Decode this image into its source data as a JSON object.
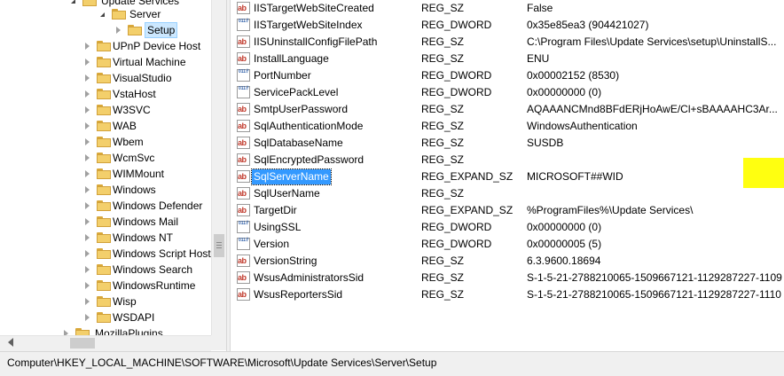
{
  "tree": {
    "nodes": [
      {
        "label": "Update Services",
        "state": "expanded"
      },
      {
        "label": "Server",
        "state": "expanded"
      },
      {
        "label": "Setup",
        "state": "none",
        "selected": true
      },
      {
        "label": "UPnP Device Host",
        "state": "collapsed"
      },
      {
        "label": "Virtual Machine",
        "state": "collapsed"
      },
      {
        "label": "VisualStudio",
        "state": "collapsed"
      },
      {
        "label": "VstaHost",
        "state": "collapsed"
      },
      {
        "label": "W3SVC",
        "state": "collapsed"
      },
      {
        "label": "WAB",
        "state": "collapsed"
      },
      {
        "label": "Wbem",
        "state": "collapsed"
      },
      {
        "label": "WcmSvc",
        "state": "collapsed"
      },
      {
        "label": "WIMMount",
        "state": "collapsed"
      },
      {
        "label": "Windows",
        "state": "collapsed"
      },
      {
        "label": "Windows Defender",
        "state": "collapsed"
      },
      {
        "label": "Windows Mail",
        "state": "collapsed"
      },
      {
        "label": "Windows NT",
        "state": "collapsed"
      },
      {
        "label": "Windows Script Host",
        "state": "collapsed"
      },
      {
        "label": "Windows Search",
        "state": "collapsed"
      },
      {
        "label": "WindowsRuntime",
        "state": "collapsed"
      },
      {
        "label": "Wisp",
        "state": "collapsed"
      },
      {
        "label": "WSDAPI",
        "state": "collapsed"
      },
      {
        "label": "MozillaPlugins",
        "state": "collapsed"
      }
    ]
  },
  "values": {
    "rows": [
      {
        "icon": "string-value-icon",
        "name": "IISTargetWebSiteCreated",
        "type": "REG_SZ",
        "data": "False"
      },
      {
        "icon": "binary-value-icon",
        "name": "IISTargetWebSiteIndex",
        "type": "REG_DWORD",
        "data": "0x35e85ea3 (904421027)"
      },
      {
        "icon": "string-value-icon",
        "name": "IISUninstallConfigFilePath",
        "type": "REG_SZ",
        "data": "C:\\Program Files\\Update Services\\setup\\UninstallS..."
      },
      {
        "icon": "string-value-icon",
        "name": "InstallLanguage",
        "type": "REG_SZ",
        "data": "ENU"
      },
      {
        "icon": "binary-value-icon",
        "name": "PortNumber",
        "type": "REG_DWORD",
        "data": "0x00002152 (8530)"
      },
      {
        "icon": "binary-value-icon",
        "name": "ServicePackLevel",
        "type": "REG_DWORD",
        "data": "0x00000000 (0)"
      },
      {
        "icon": "string-value-icon",
        "name": "SmtpUserPassword",
        "type": "REG_SZ",
        "data": "AQAAANCMnd8BFdERjHoAwE/Cl+sBAAAAHC3Ar..."
      },
      {
        "icon": "string-value-icon",
        "name": "SqlAuthenticationMode",
        "type": "REG_SZ",
        "data": "WindowsAuthentication"
      },
      {
        "icon": "string-value-icon",
        "name": "SqlDatabaseName",
        "type": "REG_SZ",
        "data": "SUSDB"
      },
      {
        "icon": "string-value-icon",
        "name": "SqlEncryptedPassword",
        "type": "REG_SZ",
        "data": ""
      },
      {
        "icon": "string-value-icon",
        "name": "SqlServerName",
        "type": "REG_EXPAND_SZ",
        "data": "MICROSOFT##WID",
        "selected": true
      },
      {
        "icon": "string-value-icon",
        "name": "SqlUserName",
        "type": "REG_SZ",
        "data": ""
      },
      {
        "icon": "string-value-icon",
        "name": "TargetDir",
        "type": "REG_EXPAND_SZ",
        "data": "%ProgramFiles%\\Update Services\\"
      },
      {
        "icon": "binary-value-icon",
        "name": "UsingSSL",
        "type": "REG_DWORD",
        "data": "0x00000000 (0)"
      },
      {
        "icon": "binary-value-icon",
        "name": "Version",
        "type": "REG_DWORD",
        "data": "0x00000005 (5)"
      },
      {
        "icon": "string-value-icon",
        "name": "VersionString",
        "type": "REG_SZ",
        "data": "6.3.9600.18694"
      },
      {
        "icon": "string-value-icon",
        "name": "WsusAdministratorsSid",
        "type": "REG_SZ",
        "data": "S-1-5-21-2788210065-1509667121-1129287227-1109"
      },
      {
        "icon": "string-value-icon",
        "name": "WsusReportersSid",
        "type": "REG_SZ",
        "data": "S-1-5-21-2788210065-1509667121-1129287227-1110"
      }
    ]
  },
  "status_bar": {
    "path": "Computer\\HKEY_LOCAL_MACHINE\\SOFTWARE\\Microsoft\\Update Services\\Server\\Setup"
  },
  "colors": {
    "highlight": "#ffff10",
    "selection": "#3399ff"
  }
}
